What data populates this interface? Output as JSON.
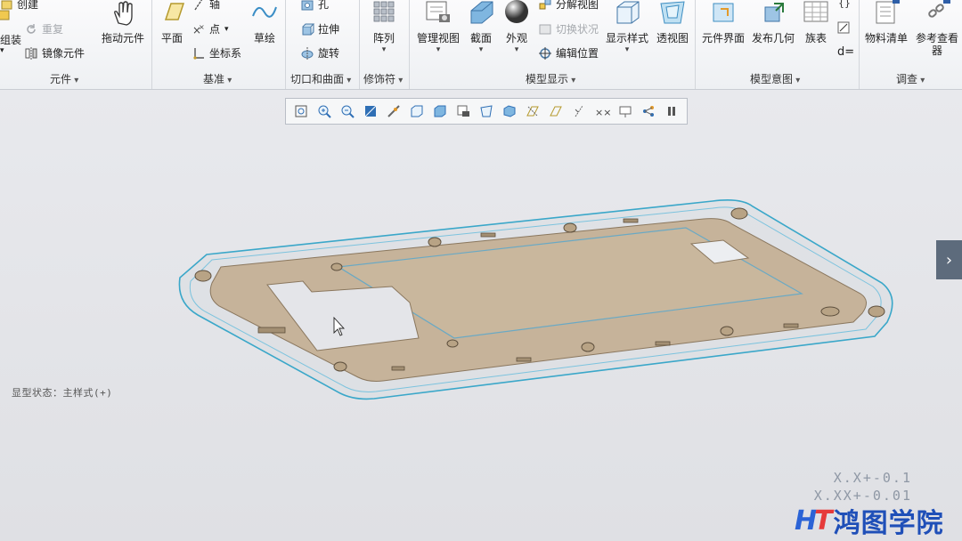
{
  "ribbon": {
    "groups": {
      "components": "元件",
      "datum": "基准",
      "cut_surface": "切口和曲面",
      "modifiers": "修饰符",
      "model_display": "模型显示",
      "model_intent": "模型意图",
      "investigate": "调查"
    },
    "left": {
      "create": "创建",
      "assemble": "组装",
      "repeat": "重复",
      "mirror_component": "镜像元件",
      "drag_components": "拖动元件"
    },
    "datum": {
      "plane": "平面",
      "axis": "轴",
      "point": "点",
      "csys": "坐标系",
      "sketch": "草绘"
    },
    "cut": {
      "hole": "孔",
      "extrude": "拉伸",
      "revolve": "旋转"
    },
    "modifiers": {
      "pattern": "阵列"
    },
    "display": {
      "manage_views": "管理视图",
      "section": "截面",
      "appearance": "外观",
      "exploded_view": "分解视图",
      "toggle_status": "切换状况",
      "edit_position": "编辑位置",
      "display_style": "显示样式",
      "perspective": "透视图"
    },
    "intent": {
      "component_interface": "元件界面",
      "publish_geometry": "发布几何",
      "family_table": "族表",
      "relations": "d="
    },
    "investigate": {
      "bom": "物料清单",
      "reference_viewer": "参考查看器"
    }
  },
  "viewport": {
    "state_label": "显型状态：主样式(+)",
    "tolerance_1": "X.X+-0.1",
    "tolerance_2": "X.XX+-0.01",
    "next_arrow": "›"
  },
  "brand": {
    "mark_h": "H",
    "mark_t": "T",
    "name": "鸿图学院"
  },
  "icons": {
    "view_toolbar": [
      "refit-icon",
      "zoom-in-icon",
      "zoom-out-icon",
      "repaint-icon",
      "view-orient-icon",
      "saved-views-icon",
      "display-style-icon",
      "view-manager-icon",
      "perspective-icon",
      "datum-display-icon",
      "plane-display-icon",
      "axis-display-icon",
      "point-display-icon",
      "csys-display-icon",
      "annotation-display-icon",
      "spin-center-icon",
      "pause-icon"
    ]
  },
  "colors": {
    "accent": "#2b63d6",
    "part_fill": "#c6b39a",
    "part_edge": "#3aa7c9",
    "viewport_bg": "#e3e4e8"
  }
}
